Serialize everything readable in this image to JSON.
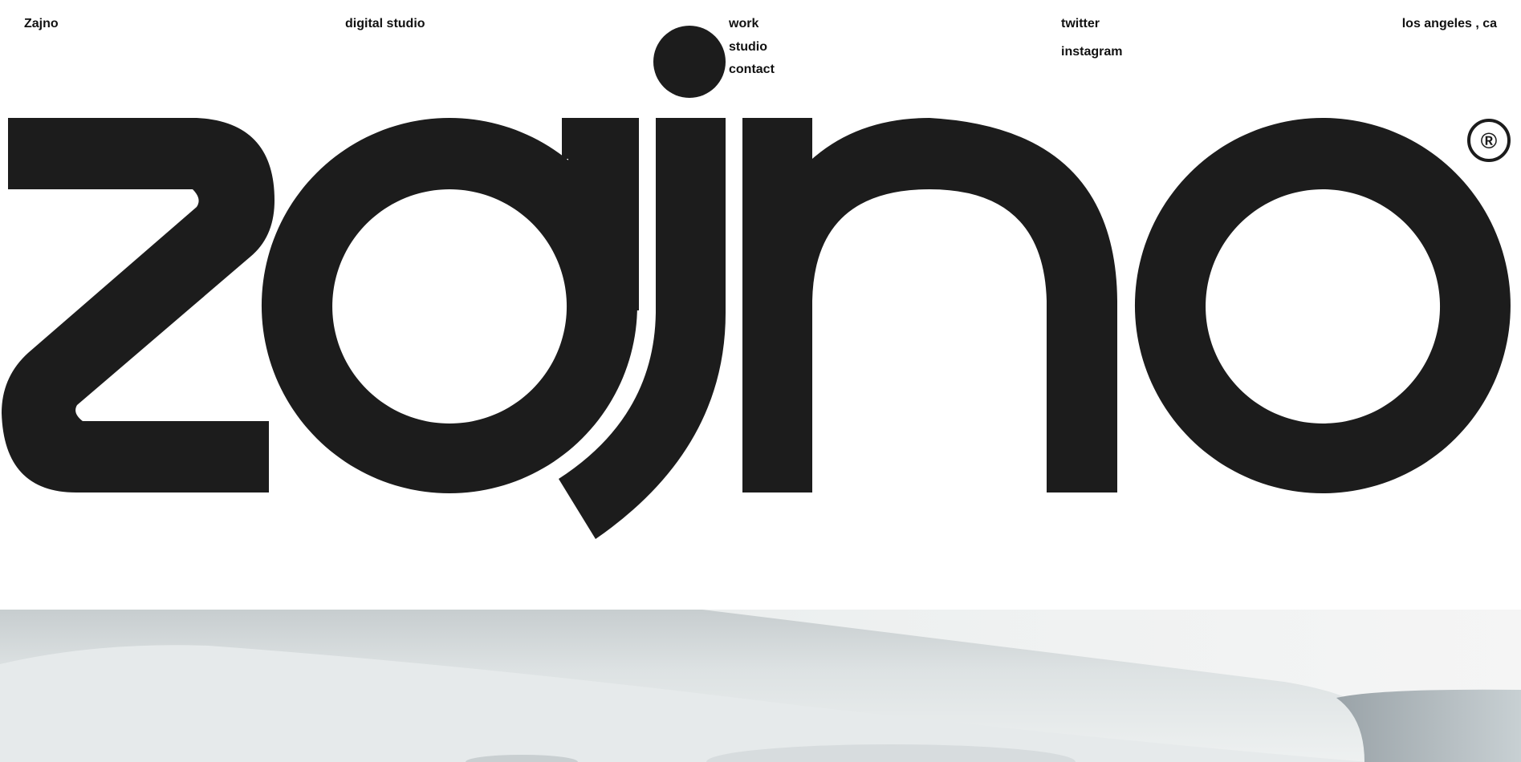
{
  "header": {
    "brand": "Zajno",
    "tagline": "digital studio",
    "nav": [
      {
        "label": "work"
      },
      {
        "label": "studio"
      },
      {
        "label": "contact"
      }
    ],
    "social": [
      {
        "label": "twitter"
      },
      {
        "label": "instagram"
      }
    ],
    "location": "los angeles , ca"
  },
  "hero": {
    "wordmark": "zajno",
    "trademark": "®"
  },
  "icons": {
    "logo_dot": "circle-logo-icon",
    "hero_image": "abstract-render-image"
  },
  "colors": {
    "ink": "#1c1c1c",
    "background": "#ffffff",
    "image_light": "#e9ecec",
    "image_shadow": "#7c858b"
  }
}
